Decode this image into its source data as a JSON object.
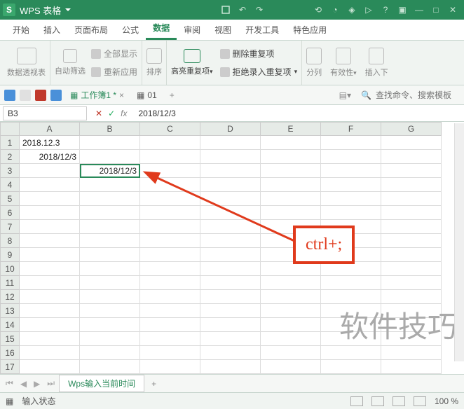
{
  "app": {
    "name": "WPS 表格"
  },
  "menu": {
    "items": [
      "开始",
      "插入",
      "页面布局",
      "公式",
      "数据",
      "审阅",
      "视图",
      "开发工具",
      "特色应用"
    ],
    "active_index": 4
  },
  "ribbon": {
    "pivot": "数据透视表",
    "autofilter": "自动筛选",
    "showall": "全部显示",
    "reapply": "重新应用",
    "sort": "排序",
    "highlight_dup": "高亮重复项",
    "remove_dup": "删除重复项",
    "reject_dup": "拒绝录入重复项",
    "split": "分列",
    "validity": "有效性",
    "insert_dropdown": "插入下"
  },
  "docbar": {
    "tab1": "工作簿1 *",
    "tab2": "01",
    "search_placeholder": "查找命令、搜索模板"
  },
  "formula_bar": {
    "name_box": "B3",
    "value": "2018/12/3"
  },
  "columns": [
    "A",
    "B",
    "C",
    "D",
    "E",
    "F",
    "G"
  ],
  "row_count": 17,
  "cells": {
    "A1": "2018.12.3",
    "A2": "2018/12/3",
    "B3": "2018/12/3"
  },
  "selected_cell": "B3",
  "annotation": {
    "text": "ctrl+;"
  },
  "sheet_tab": "Wps输入当前时间",
  "status": {
    "label": "输入状态",
    "zoom": "100 %"
  },
  "watermark": "软件技巧"
}
